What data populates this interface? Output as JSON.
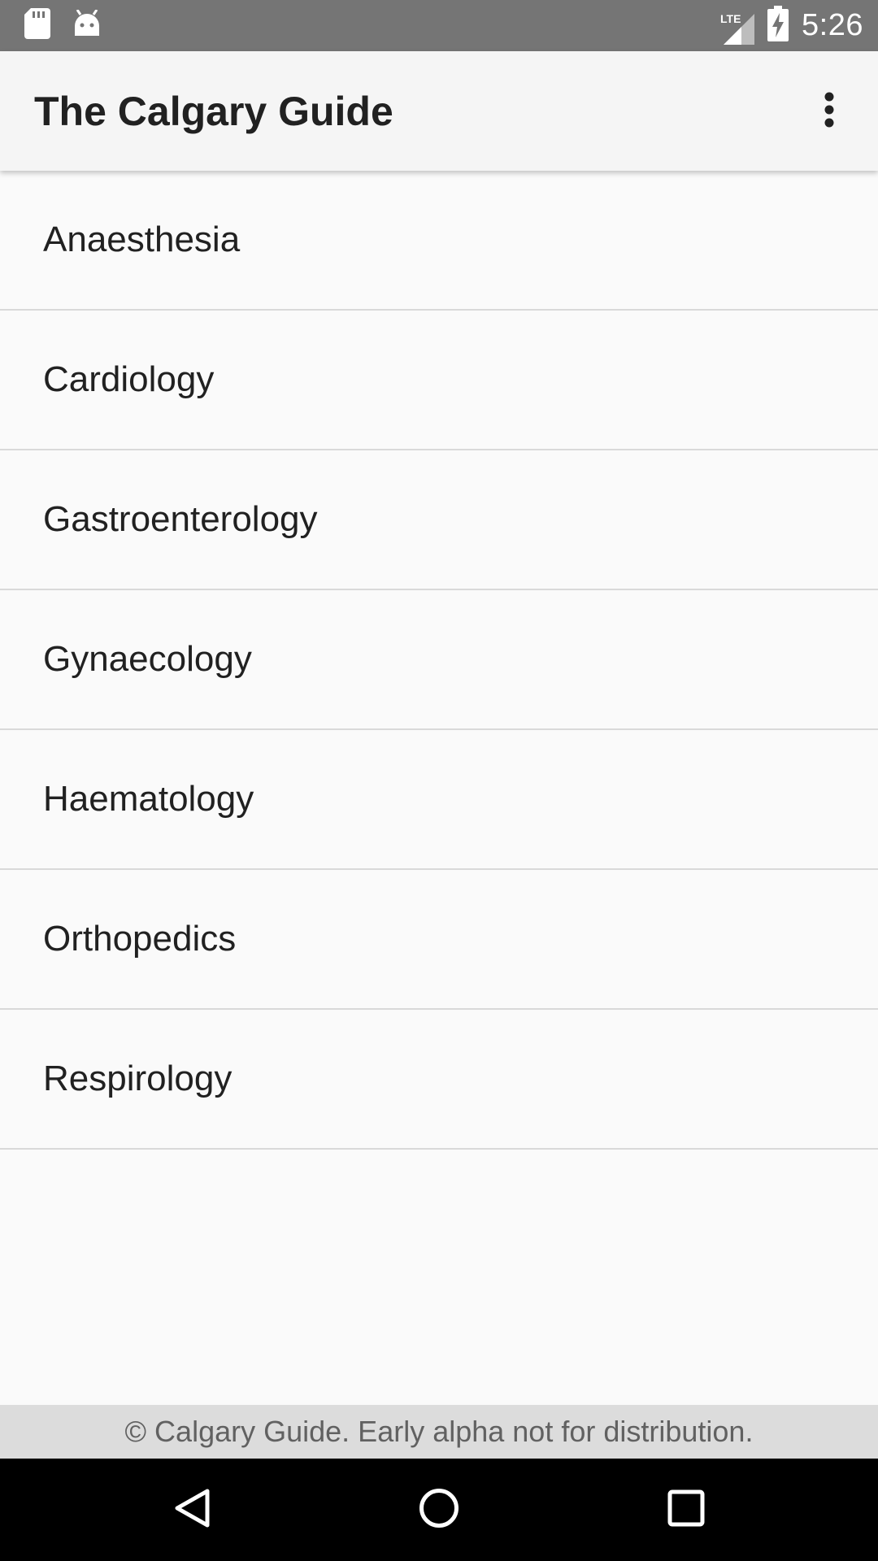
{
  "status_bar": {
    "time": "5:26",
    "network_label": "LTE",
    "icons": [
      "sd-card-icon",
      "android-debug-icon",
      "signal-icon",
      "battery-charging-icon"
    ]
  },
  "app_bar": {
    "title": "The Calgary Guide",
    "overflow_icon": "more-vert-icon"
  },
  "categories": [
    {
      "label": "Anaesthesia"
    },
    {
      "label": "Cardiology"
    },
    {
      "label": "Gastroenterology"
    },
    {
      "label": "Gynaecology"
    },
    {
      "label": "Haematology"
    },
    {
      "label": "Orthopedics"
    },
    {
      "label": "Respirology"
    }
  ],
  "footer": {
    "text": "© Calgary Guide. Early alpha not for distribution."
  },
  "nav_bar": {
    "icons": [
      "back-icon",
      "home-icon",
      "recents-icon"
    ]
  },
  "colors": {
    "status_bar": "#757575",
    "app_bar": "#f5f5f5",
    "background": "#fafafa",
    "footer": "#dcdcdc",
    "nav_bar": "#000000"
  }
}
